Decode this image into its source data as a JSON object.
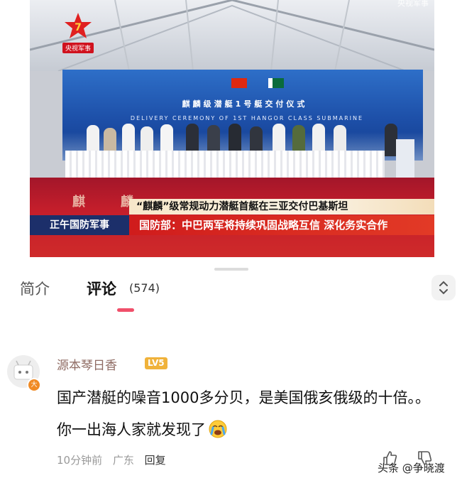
{
  "video": {
    "channel_label": "央视军事",
    "watermark": "央视军事",
    "ceremony_title": "麒麟级潜艇1号艇交付仪式",
    "ceremony_subtitle": "DELIVERY CEREMONY OF 1ST HANGOR CLASS SUBMARINE",
    "ghost_title": "麒麟",
    "ticker_headline": "“麒麟”级常规动力潜艇首艇在三亚交付巴基斯坦",
    "ticker_program": "正午国防军事",
    "ticker_main": "国防部：中巴两军将持续巩固战略互信 深化务实合作",
    "colors": {
      "stage_red": "#c41e2b",
      "backdrop_blue": "#1d4fa8",
      "ticker_navy": "#1c2f6a"
    }
  },
  "tabs": {
    "intro_label": "简介",
    "comments_label": "评论",
    "comments_count": "(574)",
    "active": "评论",
    "indicator_color": "#f04f6a",
    "expand_icon": "chevron-up-down-icon"
  },
  "comment": {
    "username": "源本琴日香",
    "level": "LV5",
    "avatar_badge": "大",
    "text": "国产潜艇的噪音1000多分贝，是美国俄亥俄级的十倍。。你一出海人家就发现了",
    "emoji": "crying-face-icon",
    "time": "10分钟前",
    "location": "广东",
    "reply_label": "回复",
    "like_icon": "thumbs-up-icon",
    "dislike_icon": "thumbs-down-icon"
  },
  "watermark_bottom": "头条 @争晓渡"
}
